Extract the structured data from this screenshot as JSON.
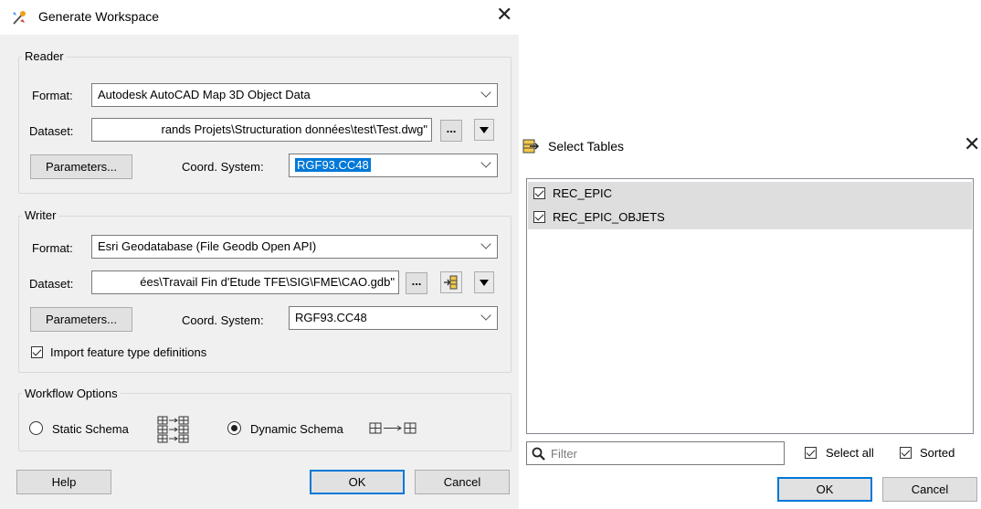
{
  "generate_workspace": {
    "title": "Generate Workspace",
    "reader": {
      "group_label": "Reader",
      "format_label": "Format:",
      "format_value": "Autodesk AutoCAD Map 3D Object Data",
      "dataset_label": "Dataset:",
      "dataset_value": "rands Projets\\Structuration données\\test\\Test.dwg\"",
      "browse_label": "...",
      "parameters_label": "Parameters...",
      "coord_label": "Coord. System:",
      "coord_value": "RGF93.CC48"
    },
    "writer": {
      "group_label": "Writer",
      "format_label": "Format:",
      "format_value": "Esri Geodatabase (File Geodb Open API)",
      "dataset_label": "Dataset:",
      "dataset_value": "ées\\Travail Fin d'Etude TFE\\SIG\\FME\\CAO.gdb\"",
      "browse_label": "...",
      "parameters_label": "Parameters...",
      "coord_label": "Coord. System:",
      "coord_value": "RGF93.CC48",
      "import_label": "Import feature type definitions",
      "import_checked": true
    },
    "workflow": {
      "group_label": "Workflow Options",
      "static_label": "Static Schema",
      "dynamic_label": "Dynamic Schema",
      "selected": "Dynamic Schema"
    },
    "buttons": {
      "help": "Help",
      "ok": "OK",
      "cancel": "Cancel"
    }
  },
  "select_tables": {
    "title": "Select Tables",
    "tables": [
      {
        "name": "REC_EPIC",
        "checked": true
      },
      {
        "name": "REC_EPIC_OBJETS",
        "checked": true
      }
    ],
    "filter_placeholder": "Filter",
    "select_all_label": "Select all",
    "select_all_checked": true,
    "sorted_label": "Sorted",
    "sorted_checked": true,
    "buttons": {
      "ok": "OK",
      "cancel": "Cancel"
    }
  },
  "colors": {
    "dialog_bg": "#f0f0f0",
    "selection": "#0078d7",
    "list_row": "#dedede"
  }
}
